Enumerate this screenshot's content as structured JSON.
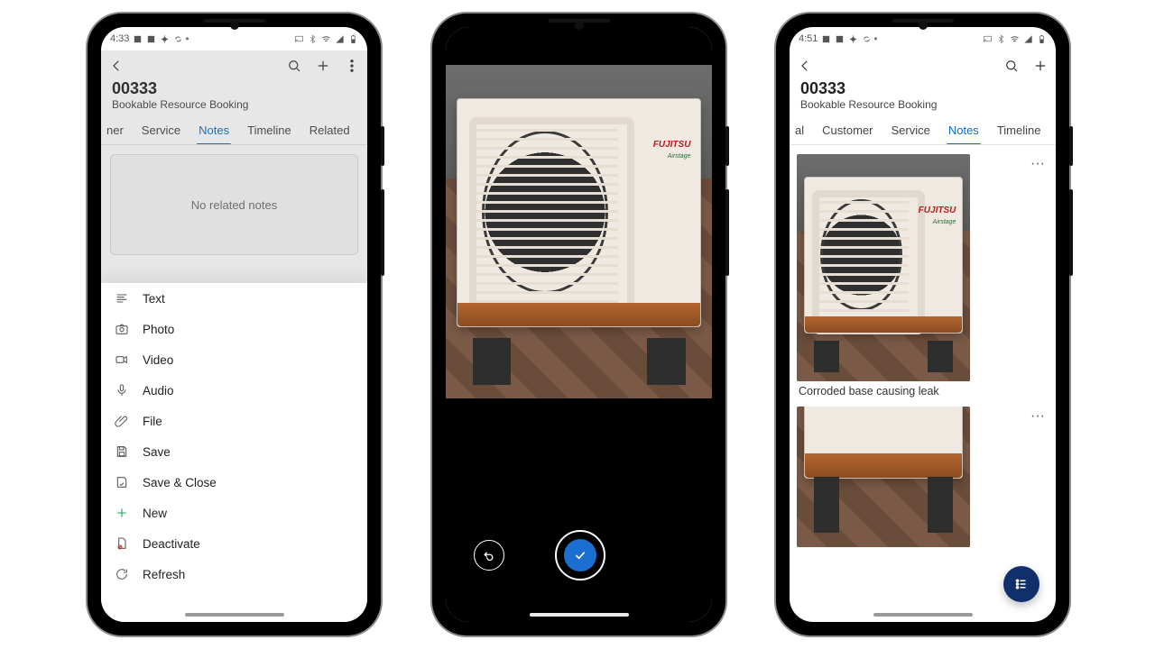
{
  "colors": {
    "accent": "#0f6cbd",
    "fab": "#102f6b",
    "shutter": "#1a6fd1"
  },
  "phone1": {
    "status_time": "4:33",
    "record_title": "00333",
    "record_subtitle": "Bookable Resource Booking",
    "tabs": [
      "ner",
      "Service",
      "Notes",
      "Timeline",
      "Related"
    ],
    "active_tab_index": 2,
    "empty_text": "No related notes",
    "menu": {
      "text": "Text",
      "photo": "Photo",
      "video": "Video",
      "audio": "Audio",
      "file": "File",
      "save": "Save",
      "save_close": "Save & Close",
      "new": "New",
      "deactivate": "Deactivate",
      "refresh": "Refresh"
    }
  },
  "phone2": {
    "camera_subject": "Outdoor AC condenser unit with corroded base",
    "brand_text": "FUJITSU",
    "model_text": "Airstage"
  },
  "phone3": {
    "status_time": "4:51",
    "record_title": "00333",
    "record_subtitle": "Bookable Resource Booking",
    "tabs": [
      "al",
      "Customer",
      "Service",
      "Notes",
      "Timeline"
    ],
    "active_tab_index": 3,
    "notes": [
      {
        "caption": "Corroded base causing leak"
      },
      {
        "caption": ""
      }
    ]
  }
}
